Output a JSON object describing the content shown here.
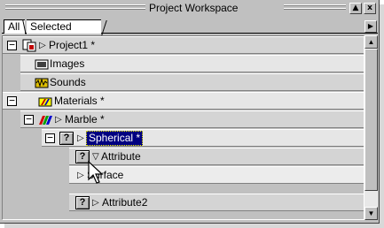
{
  "window": {
    "title": "Project Workspace"
  },
  "title_buttons": {
    "minimize": "▲",
    "close": "x"
  },
  "tabs": [
    {
      "label": "All"
    },
    {
      "label": "Selected"
    }
  ],
  "tree": {
    "items": [
      {
        "label": "Project1 *"
      },
      {
        "label": "Images"
      },
      {
        "label": "Sounds"
      },
      {
        "label": "Materials *"
      },
      {
        "label": "Marble *"
      },
      {
        "label": "Spherical *"
      },
      {
        "label": "Attribute"
      },
      {
        "label": "Surface"
      },
      {
        "label": "Attribute2"
      }
    ]
  },
  "glyphs": {
    "expanded": "−",
    "triangle_right": "▷",
    "triangle_down": "▽",
    "unknown": "?"
  },
  "colors": {
    "selection_bg": "#000080",
    "panel_bg": "#c0c0c0",
    "row_bg": "#d4d4d4"
  }
}
